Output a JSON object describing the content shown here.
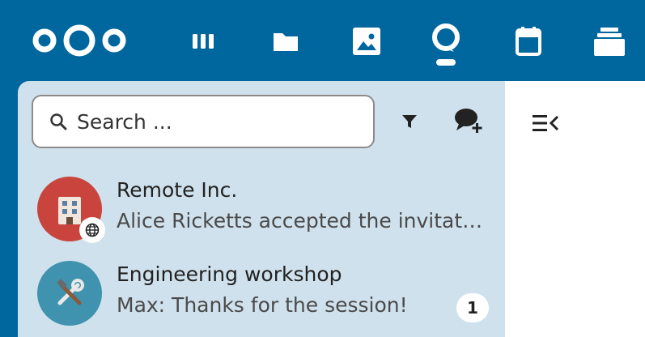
{
  "header": {
    "apps": [
      {
        "name": "dashboard-icon"
      },
      {
        "name": "folder-icon"
      },
      {
        "name": "image-icon"
      },
      {
        "name": "talk-icon"
      },
      {
        "name": "calendar-icon"
      },
      {
        "name": "deck-icon"
      }
    ]
  },
  "sidebar": {
    "search": {
      "placeholder": "Search ..."
    },
    "conversations": [
      {
        "title": "Remote Inc.",
        "last_message": "Alice Ricketts accepted the invitation",
        "avatar_color": "#c9443c",
        "federated": true
      },
      {
        "title": "Engineering workshop",
        "last_message": "Max: Thanks for the session!",
        "avatar_color": "#3f93ae",
        "unread": "1"
      }
    ]
  },
  "colors": {
    "header": "#00679e",
    "sidebar": "#cfe1ec",
    "main": "#ffffff"
  }
}
